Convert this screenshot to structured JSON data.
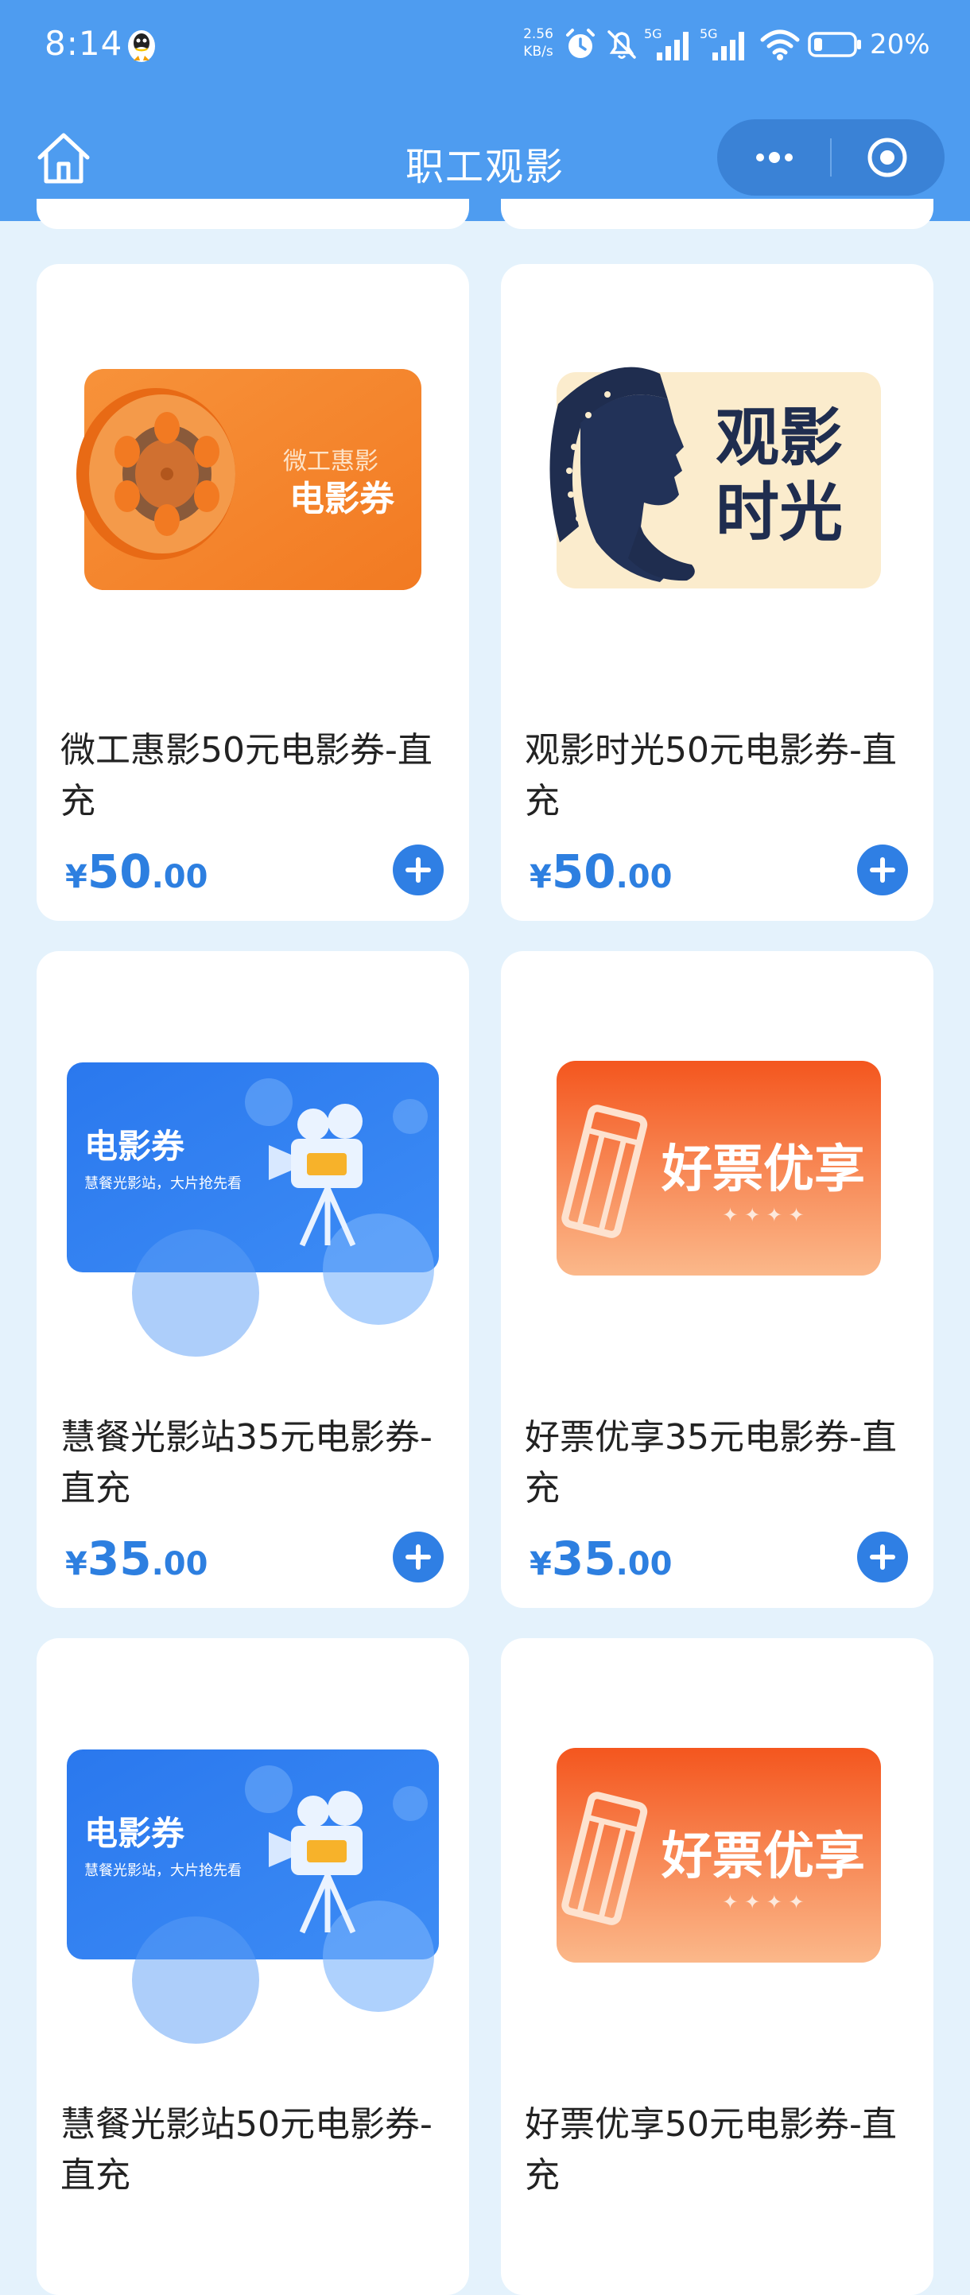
{
  "status_bar": {
    "time": "8:14",
    "net_speed_value": "2.56",
    "net_speed_unit": "KB/s",
    "signal_1": "5G",
    "signal_2": "5G",
    "battery": "20%"
  },
  "nav": {
    "title": "职工观影"
  },
  "products": [
    {
      "name": "微工惠影50元电影券-直充",
      "price_currency": "¥",
      "price_int": "50",
      "price_dec": ".00",
      "image": {
        "small_text": "微工惠影",
        "big_text": "电影券",
        "bg": "#f5862e"
      }
    },
    {
      "name": "观影时光50元电影券-直充",
      "price_currency": "¥",
      "price_int": "50",
      "price_dec": ".00",
      "image": {
        "line1": "观影",
        "line2": "时光",
        "bg": "#fbeccd"
      }
    },
    {
      "name": "慧餐光影站35元电影券-直充",
      "price_currency": "¥",
      "price_int": "35",
      "price_dec": ".00",
      "image": {
        "title": "电影券",
        "subtitle": "慧餐光影站，大片抢先看",
        "bg": "#2f7ef0"
      }
    },
    {
      "name": "好票优享35元电影券-直充",
      "price_currency": "¥",
      "price_int": "35",
      "price_dec": ".00",
      "image": {
        "title": "好票优享",
        "bg": "#f4652a"
      }
    },
    {
      "name": "慧餐光影站50元电影券-直充",
      "image": {
        "title": "电影券",
        "subtitle": "慧餐光影站，大片抢先看",
        "bg": "#2f7ef0"
      }
    },
    {
      "name": "好票优享50元电影券-直充",
      "image": {
        "title": "好票优享",
        "bg": "#f4652a"
      }
    }
  ],
  "colors": {
    "header": "#4e9cf0",
    "background": "#e4f2fc",
    "price": "#2d7fe0",
    "add_button": "#2f7fe4"
  }
}
